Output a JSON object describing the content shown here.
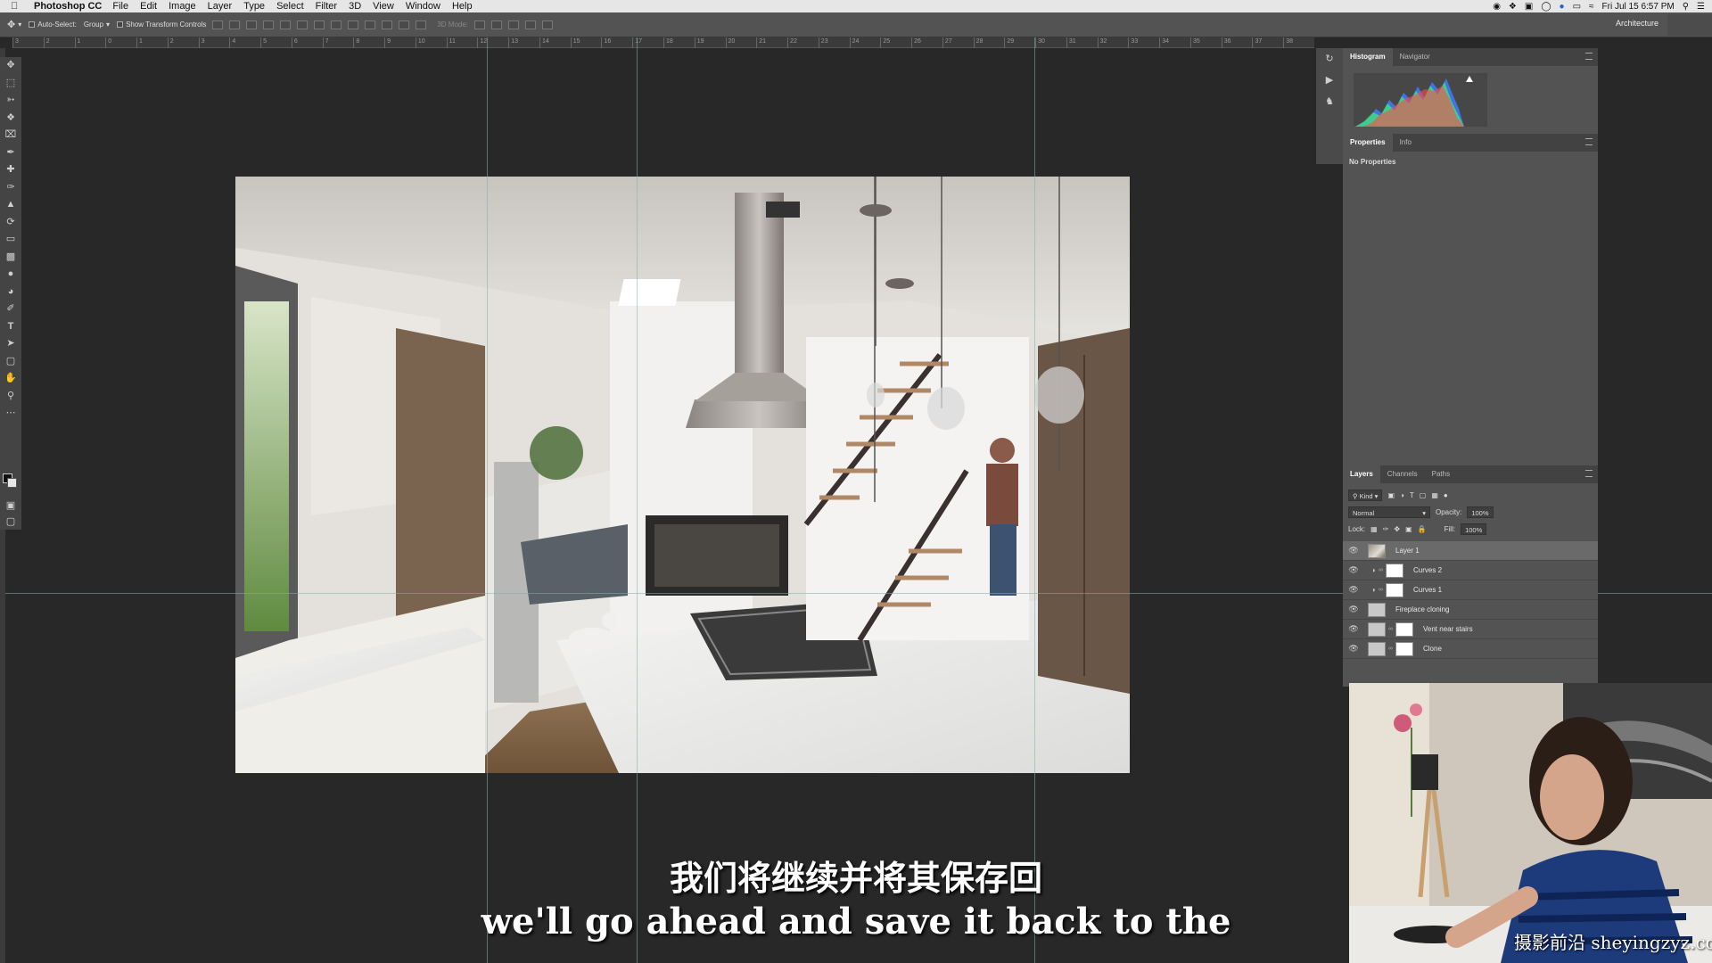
{
  "menubar": {
    "app_name": "Photoshop CC",
    "items": [
      "File",
      "Edit",
      "Image",
      "Layer",
      "Type",
      "Select",
      "Filter",
      "3D",
      "View",
      "Window",
      "Help"
    ],
    "clock": "Fri Jul 15  6:57 PM"
  },
  "options_bar": {
    "auto_select_label": "Auto-Select:",
    "auto_select_value": "Group",
    "show_transform_label": "Show Transform Controls",
    "mode_3d_label": "3D Mode:",
    "workspace": "Architecture"
  },
  "ruler": {
    "numbers": [
      "3",
      "2",
      "1",
      "0",
      "1",
      "2",
      "3",
      "4",
      "5",
      "6",
      "7",
      "8",
      "9",
      "10",
      "11",
      "12",
      "13",
      "14",
      "15",
      "16",
      "17",
      "18",
      "19",
      "20",
      "21",
      "22",
      "23",
      "24",
      "25",
      "26",
      "27",
      "28",
      "29",
      "30",
      "31",
      "32",
      "33",
      "34",
      "35",
      "36",
      "37",
      "38"
    ]
  },
  "panels": {
    "histogram_tabs": [
      "Histogram",
      "Navigator"
    ],
    "properties_tabs": [
      "Properties",
      "Info"
    ],
    "properties_message": "No Properties",
    "layers_tabs": [
      "Layers",
      "Channels",
      "Paths"
    ],
    "filter_kind": "Kind",
    "blend_mode": "Normal",
    "opacity_label": "Opacity:",
    "opacity_value": "100%",
    "lock_label": "Lock:",
    "fill_label": "Fill:",
    "fill_value": "100%",
    "layers": [
      {
        "name": "Layer 1",
        "active": true
      },
      {
        "name": "Curves 2",
        "active": false
      },
      {
        "name": "Curves 1",
        "active": false
      },
      {
        "name": "Fireplace cloning",
        "active": false
      },
      {
        "name": "Vent near stairs",
        "active": false
      },
      {
        "name": "Clone",
        "active": false
      }
    ]
  },
  "subtitle": {
    "chinese": "我们将继续并将其保存回",
    "english": "we'll go ahead and save it back to the"
  },
  "watermark": "摄影前沿 sheyingzyz.com",
  "colors": {
    "workspace_bg": "#282828",
    "panel_bg": "#535353",
    "guide": "#82afaf",
    "histogram_green": "#3ddc84",
    "histogram_blue": "#3f7bff",
    "histogram_red": "#ff4a4a"
  },
  "icons": {
    "tools": [
      "move-icon",
      "marquee-icon",
      "lasso-icon",
      "quick-select-icon",
      "crop-icon",
      "eyedropper-icon",
      "healing-icon",
      "brush-icon",
      "stamp-icon",
      "history-brush-icon",
      "eraser-icon",
      "gradient-icon",
      "blur-icon",
      "dodge-icon",
      "pen-icon",
      "type-icon",
      "path-select-icon",
      "shape-icon",
      "hand-icon",
      "zoom-icon",
      "more-tools-icon"
    ]
  }
}
